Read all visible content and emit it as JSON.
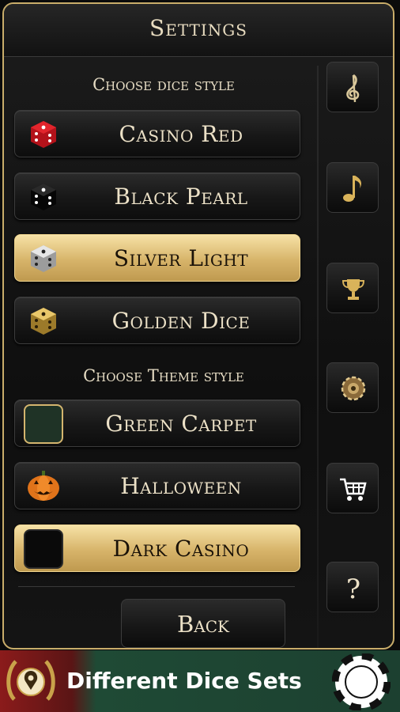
{
  "header": {
    "title": "Settings"
  },
  "dice_section": {
    "title": "Choose dice style",
    "options": [
      {
        "label": "Casino Red",
        "selected": false,
        "icon": "red-dice-icon",
        "color": "#c4161c"
      },
      {
        "label": "Black Pearl",
        "selected": false,
        "icon": "black-dice-icon",
        "color": "#111111"
      },
      {
        "label": "Silver Light",
        "selected": true,
        "icon": "silver-dice-icon",
        "color": "#cfcfcf"
      },
      {
        "label": "Golden Dice",
        "selected": false,
        "icon": "golden-dice-icon",
        "color": "#c9a24a"
      }
    ]
  },
  "theme_section": {
    "title": "Choose Theme style",
    "options": [
      {
        "label": "Green Carpet",
        "selected": false,
        "icon": "green-swatch-icon",
        "color": "#1f3326"
      },
      {
        "label": "Halloween",
        "selected": false,
        "icon": "pumpkin-icon",
        "color": "#e0731a"
      },
      {
        "label": "Dark Casino",
        "selected": true,
        "icon": "dark-swatch-icon",
        "color": "#0a0a0a"
      }
    ]
  },
  "back_button": {
    "label": "Back"
  },
  "sidebar": {
    "buttons": [
      {
        "icon": "treble-clef-icon"
      },
      {
        "icon": "music-note-icon"
      },
      {
        "icon": "trophy-icon"
      },
      {
        "icon": "chip-settings-icon"
      },
      {
        "icon": "shopping-cart-icon"
      },
      {
        "icon": "help-icon"
      }
    ]
  },
  "banner": {
    "text": "Different Dice Sets"
  },
  "colors": {
    "accent_gold": "#c9ad6a",
    "selected_gold": "#d7b46a",
    "text_cream": "#ece1c7"
  }
}
